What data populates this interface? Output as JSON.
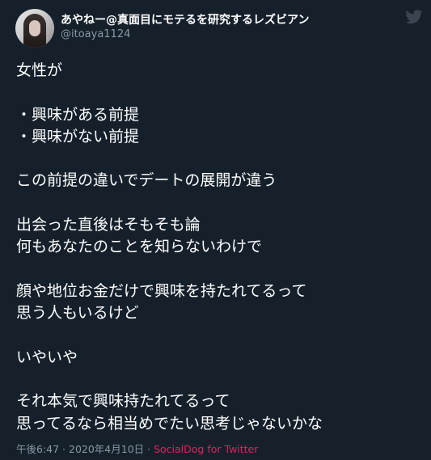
{
  "tweet": {
    "display_name": "あやねー@真面目にモテるを研究するレズビアン",
    "handle": "@itoaya1124",
    "lines": [
      "女性が",
      "",
      "・興味がある前提",
      "・興味がない前提",
      "",
      "この前提の違いでデートの展開が違う",
      "",
      "出会った直後はそもそも論",
      "何もあなたのことを知らないわけで",
      "",
      "顔や地位お金だけで興味を持たれてるって",
      "思う人もいるけど",
      "",
      "いやいや",
      "",
      "それ本気で興味持たれてるって",
      "思ってるなら相当めでたい思考じゃないかな"
    ],
    "time": "午後6:47",
    "separator": " · ",
    "date": "2020年4月10日",
    "source": "SocialDog for Twitter",
    "icons": {
      "brand": "twitter-bird-icon"
    },
    "colors": {
      "background": "#15202b",
      "text": "#ffffff",
      "muted": "#8899a6",
      "source_link": "#e0245e"
    }
  }
}
